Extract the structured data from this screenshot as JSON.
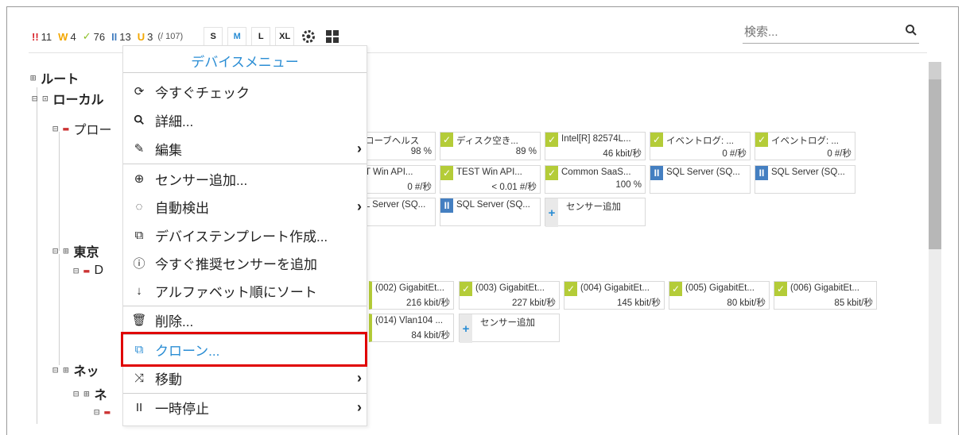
{
  "toolbar": {
    "counts": [
      {
        "symbol": "!!",
        "value": "11",
        "color": "#d8232a"
      },
      {
        "symbol": "W",
        "value": "4",
        "color": "#f3a700"
      },
      {
        "symbol": "✓",
        "value": "76",
        "color": "#8cbf26"
      },
      {
        "symbol": "II",
        "value": "13",
        "color": "#447fc1"
      },
      {
        "symbol": "U",
        "value": "3",
        "color": "#f3a700"
      }
    ],
    "total": "(/ 107)",
    "sizes": [
      "S",
      "M",
      "L",
      "XL"
    ],
    "active_size": "M",
    "settings_icon": "gear-icon",
    "layout_icon": "grid-icon"
  },
  "search": {
    "placeholder": "検索...",
    "icon": "search-icon"
  },
  "tree": {
    "root": "ルート",
    "local": "ローカル",
    "probe": "プロー",
    "tokyo": "東京",
    "d_device": "D",
    "network": "ネッ",
    "net_child": "ネ"
  },
  "sensors_row1": [
    {
      "name": "ローブヘルス",
      "value": "98 %",
      "status": "ok"
    },
    {
      "name": "ディスク空き...",
      "value": "89 %",
      "status": "ok"
    },
    {
      "name": "Intel[R] 82574L...",
      "value": "46 kbit/秒",
      "status": "ok"
    },
    {
      "name": "イベントログ: ...",
      "value": "0 #/秒",
      "status": "ok"
    },
    {
      "name": "イベントログ: ...",
      "value": "0 #/秒",
      "status": "ok"
    }
  ],
  "sensors_row2": [
    {
      "name": "T Win API...",
      "value": "0 #/秒",
      "status": "ok"
    },
    {
      "name": "TEST Win API...",
      "value": "< 0.01 #/秒",
      "status": "ok"
    },
    {
      "name": "Common SaaS...",
      "value": "100 %",
      "status": "ok"
    },
    {
      "name": "SQL Server (SQ...",
      "value": "",
      "status": "pause"
    },
    {
      "name": "SQL Server (SQ...",
      "value": "",
      "status": "pause"
    }
  ],
  "sensors_row3": [
    {
      "name": "L Server (SQ...",
      "value": "",
      "status": "pause"
    },
    {
      "name": "SQL Server (SQ...",
      "value": "",
      "status": "pause"
    },
    {
      "name": "センサー追加",
      "value": "",
      "status": "add"
    }
  ],
  "sensors_row4": [
    {
      "name": "(002) GigabitEt...",
      "value": "216 kbit/秒",
      "status": "ok"
    },
    {
      "name": "(003) GigabitEt...",
      "value": "227 kbit/秒",
      "status": "ok"
    },
    {
      "name": "(004) GigabitEt...",
      "value": "145 kbit/秒",
      "status": "ok"
    },
    {
      "name": "(005) GigabitEt...",
      "value": "80 kbit/秒",
      "status": "ok"
    },
    {
      "name": "(006) GigabitEt...",
      "value": "85 kbit/秒",
      "status": "ok"
    }
  ],
  "sensors_row5": [
    {
      "name": "(014) Vlan104 ...",
      "value": "84 kbit/秒",
      "status": "ok"
    },
    {
      "name": "センサー追加",
      "value": "",
      "status": "add"
    }
  ],
  "menu": {
    "title": "デバイスメニュー",
    "items": [
      {
        "label": "今すぐチェック",
        "icon": "refresh-icon"
      },
      {
        "label": "詳細...",
        "icon": "search-icon"
      },
      {
        "label": "編集",
        "icon": "edit-icon",
        "submenu": true
      },
      {
        "label": "センサー追加...",
        "icon": "plus-circle-icon"
      },
      {
        "label": "自動検出",
        "icon": "circle-icon",
        "submenu": true
      },
      {
        "label": "デバイステンプレート作成...",
        "icon": "copy-icon"
      },
      {
        "label": "今すぐ推奨センサーを追加",
        "icon": "info-icon"
      },
      {
        "label": "アルファベット順にソート",
        "icon": "sort-alpha-icon"
      },
      {
        "label": "削除...",
        "icon": "trash-icon"
      },
      {
        "label": "クローン...",
        "icon": "clone-icon",
        "highlighted": true
      },
      {
        "label": "移動",
        "icon": "shuffle-icon",
        "submenu": true
      },
      {
        "label": "一時停止",
        "icon": "pause-icon",
        "submenu": true
      }
    ]
  }
}
